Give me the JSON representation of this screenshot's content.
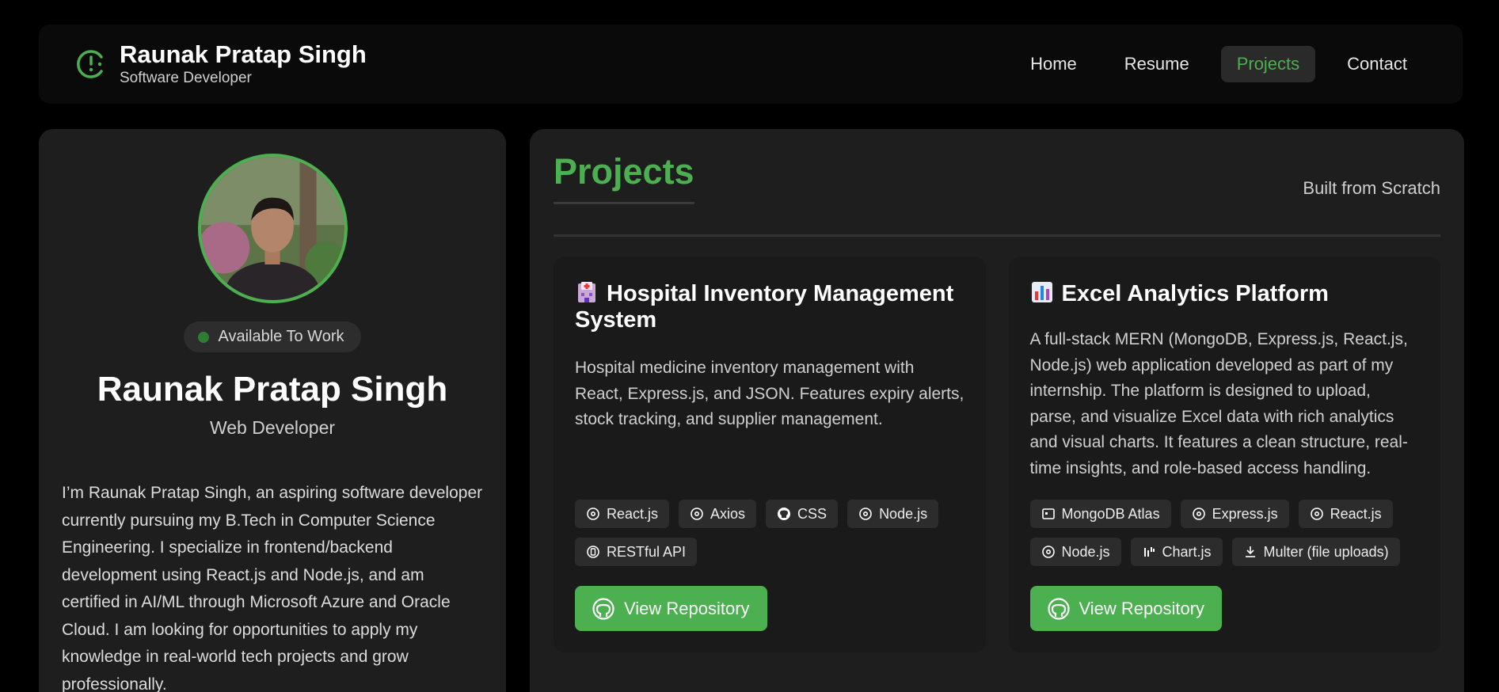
{
  "header": {
    "brand_name": "Raunak Pratap Singh",
    "brand_subtitle": "Software Developer",
    "brand_icon": "clock-icon",
    "nav": [
      {
        "label": "Home",
        "active": false
      },
      {
        "label": "Resume",
        "active": false
      },
      {
        "label": "Projects",
        "active": true
      },
      {
        "label": "Contact",
        "active": false
      }
    ]
  },
  "profile": {
    "status": "Available To Work",
    "name": "Raunak Pratap Singh",
    "role": "Web Developer",
    "bio": "I’m Raunak Pratap Singh, an aspiring software developer currently pursuing my B.Tech in Computer Science Engineering. I specialize in frontend/backend development using React.js and Node.js, and am certified in AI/ML through Microsoft Azure and Oracle Cloud. I am looking for opportunities to apply my knowledge in real-world tech projects and grow professionally."
  },
  "projects": {
    "title": "Projects",
    "tagline": "Built from Scratch",
    "items": [
      {
        "emoji": "hospital-icon",
        "title": "Hospital Inventory Management System",
        "description": "Hospital medicine inventory management with React, Express.js, and JSON. Features expiry alerts, stock tracking, and supplier management.",
        "tags": [
          {
            "label": "React.js",
            "icon": "react-icon"
          },
          {
            "label": "Axios",
            "icon": "axios-icon"
          },
          {
            "label": "CSS",
            "icon": "github-icon"
          },
          {
            "label": "Node.js",
            "icon": "node-icon"
          },
          {
            "label": "RESTful API",
            "icon": "api-icon"
          }
        ],
        "button": "View Repository"
      },
      {
        "emoji": "bar-chart-icon",
        "title": "Excel Analytics Platform",
        "description": "A full-stack MERN (MongoDB, Express.js, React.js, Node.js) web application developed as part of my internship. The platform is designed to upload, parse, and visualize Excel data with rich analytics and visual charts. It features a clean structure, real-time insights, and role-based access handling.",
        "tags": [
          {
            "label": "MongoDB Atlas",
            "icon": "database-icon"
          },
          {
            "label": "Express.js",
            "icon": "express-icon"
          },
          {
            "label": "React.js",
            "icon": "react-icon"
          },
          {
            "label": "Node.js",
            "icon": "node-icon"
          },
          {
            "label": "Chart.js",
            "icon": "chart-icon"
          },
          {
            "label": "Multer (file uploads)",
            "icon": "upload-icon"
          }
        ],
        "button": "View Repository"
      }
    ]
  },
  "colors": {
    "accent": "#4caf50",
    "background": "#000000",
    "card": "#1e1e1e"
  }
}
